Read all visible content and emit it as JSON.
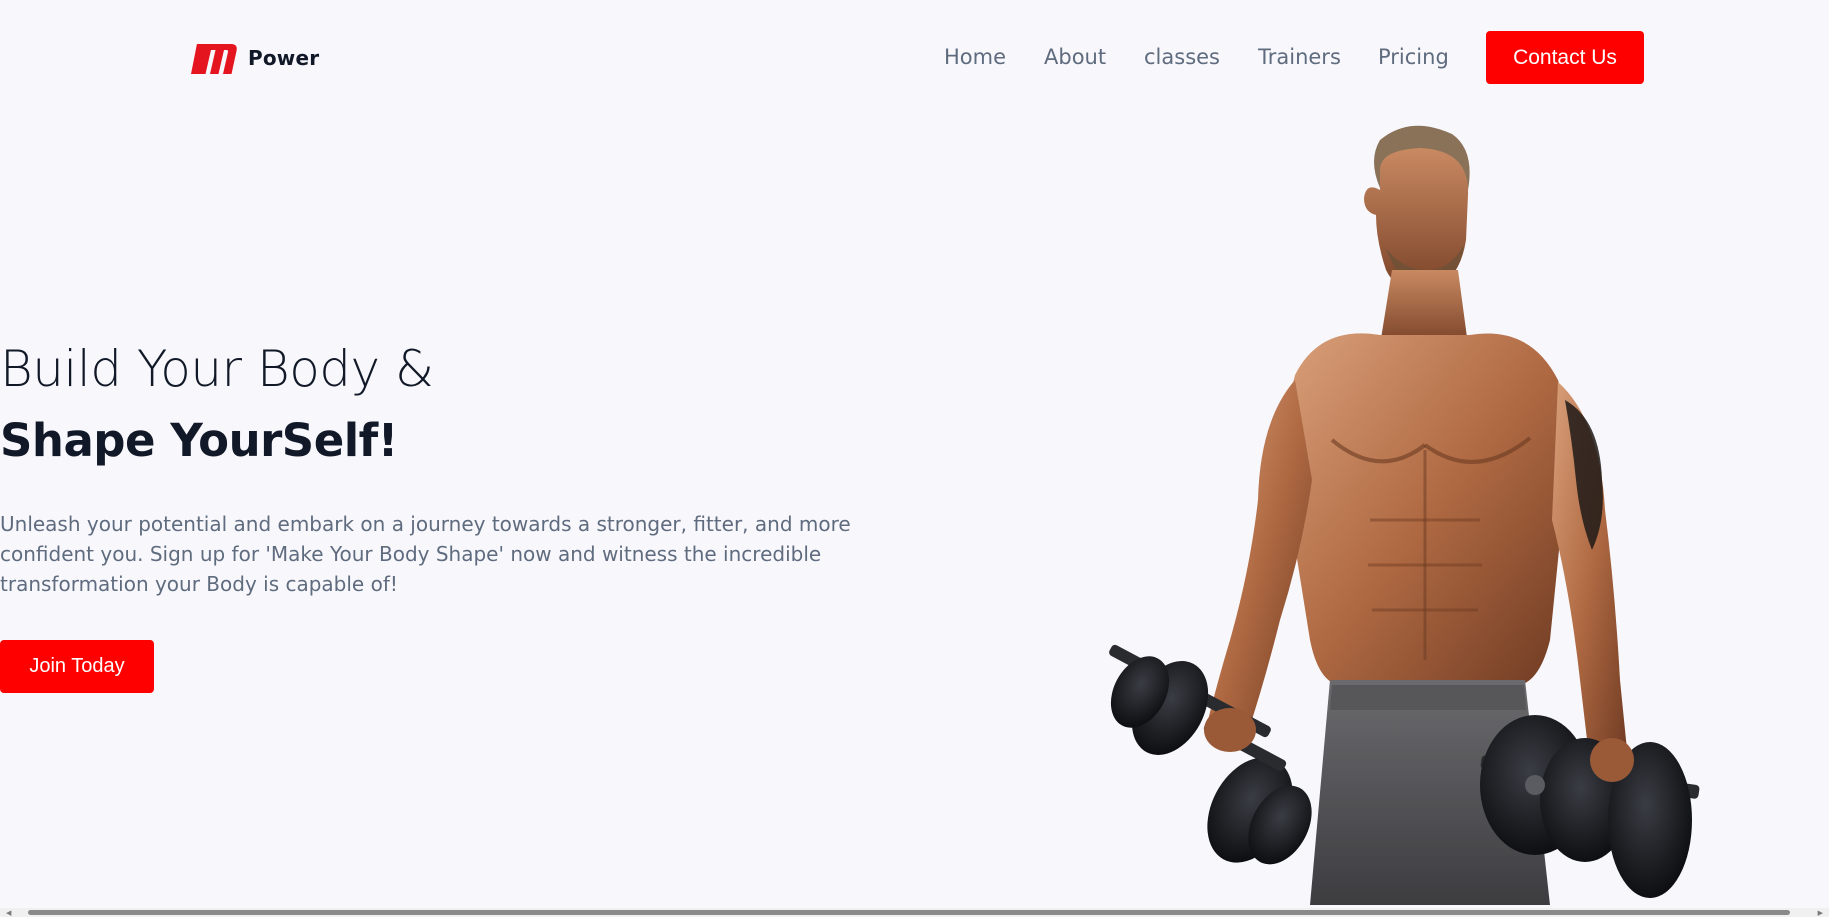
{
  "brand": {
    "name": "Power",
    "logo_icon": "m-logo-icon",
    "accent_color": "#ff0000"
  },
  "nav": {
    "items": [
      {
        "label": "Home"
      },
      {
        "label": "About"
      },
      {
        "label": "classes"
      },
      {
        "label": "Trainers"
      },
      {
        "label": "Pricing"
      }
    ],
    "cta_label": "Contact Us"
  },
  "hero": {
    "title_line1": "Build Your Body &",
    "title_line2": "Shape YourSelf!",
    "description": "Unleash your potential and embark on a journey towards a stronger, fitter, and more confident you. Sign up for 'Make Your Body Shape' now and witness the incredible transformation your Body is capable of!",
    "cta_label": "Join Today",
    "image_icon": "bodybuilder-with-dumbbells-image"
  },
  "colors": {
    "background": "#f8f8fc",
    "heading": "#111827",
    "body_text": "#5f6b7e",
    "button": "#ff0000"
  }
}
